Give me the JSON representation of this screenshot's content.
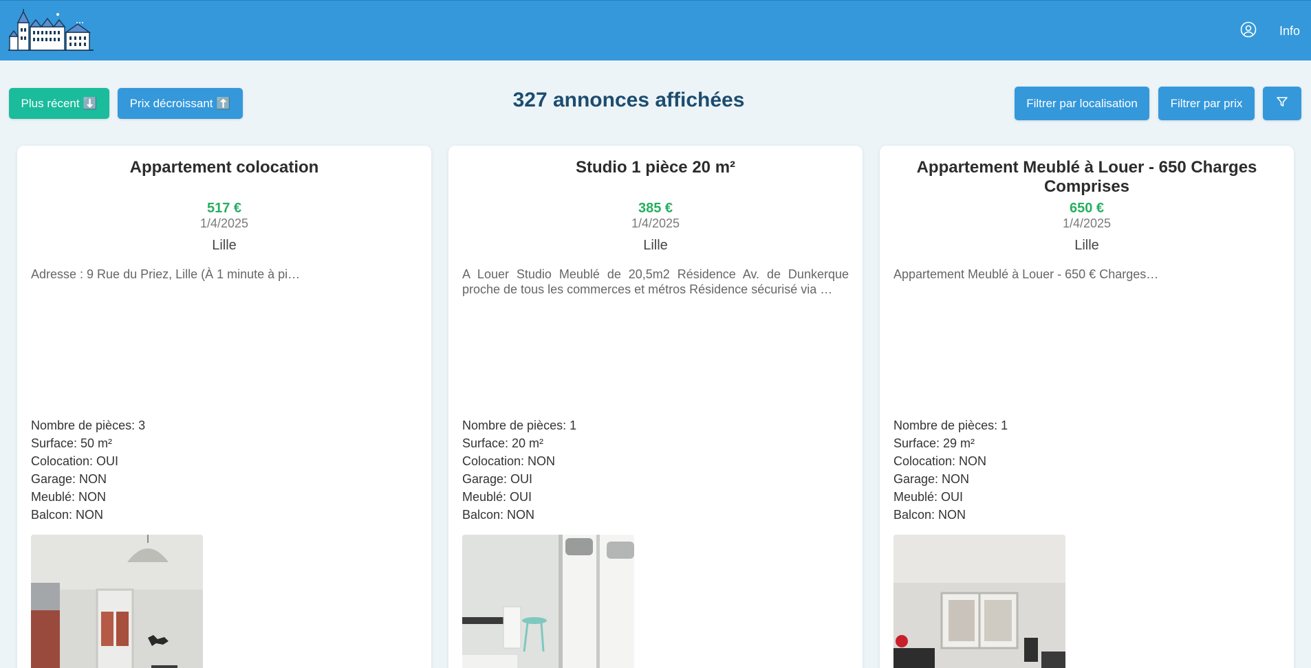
{
  "header": {
    "logo_icon": "city-buildings-logo-icon",
    "user_icon": "user-circle-icon",
    "info_label": "Info"
  },
  "toolbar": {
    "sort_recent_label": "Plus récent ⬇️",
    "sort_price_label": "Prix décroissant ⬆️",
    "count_label": "327 annonces affichées",
    "filter_location_label": "Filtrer par localisation",
    "filter_price_label": "Filtrer par prix",
    "filter_icon": "funnel-icon"
  },
  "colors": {
    "header": "#3498db",
    "accent_green": "#1abc9c",
    "price_green": "#27ae60",
    "title_dark_blue": "#1d4c6e",
    "background": "#ecf4f8"
  },
  "listings": [
    {
      "title": "Appartement colocation",
      "price": "517 €",
      "date": "1/4/2025",
      "city": "Lille",
      "description": "Adresse : 9 Rue du Priez, Lille (À 1 minute à pi…",
      "specs": [
        "Nombre de pièces: 3",
        "Surface: 50 m²",
        "Colocation: OUI",
        "Garage: NON",
        "Meublé: NON",
        "Balcon: NON"
      ],
      "photo_icon": "apartment-photo"
    },
    {
      "title": "Studio 1 pièce 20 m²",
      "price": "385 €",
      "date": "1/4/2025",
      "city": "Lille",
      "description": "A Louer Studio Meublé de 20,5m2 Résidence Av. de Dunkerque proche de tous les commerces et métros Résidence sécurisé via …",
      "specs": [
        "Nombre de pièces: 1",
        "Surface: 20 m²",
        "Colocation: NON",
        "Garage: OUI",
        "Meublé: OUI",
        "Balcon: NON"
      ],
      "photo_icon": "studio-photo"
    },
    {
      "title": "Appartement Meublé à Louer - 650 Charges Comprises",
      "price": "650 €",
      "date": "1/4/2025",
      "city": "Lille",
      "description": "Appartement Meublé à Louer - 650 € Charges…",
      "specs": [
        "Nombre de pièces: 1",
        "Surface: 29 m²",
        "Colocation: NON",
        "Garage: NON",
        "Meublé: OUI",
        "Balcon: NON"
      ],
      "photo_icon": "furnished-apartment-photo"
    }
  ]
}
